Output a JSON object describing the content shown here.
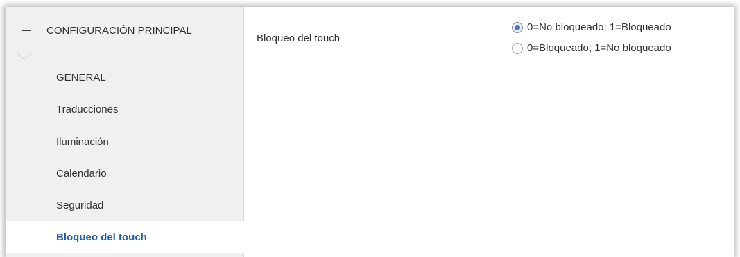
{
  "sidebar": {
    "section_title": "CONFIGURACIÓN PRINCIPAL",
    "items": [
      {
        "label": "GENERAL"
      },
      {
        "label": "Traducciones"
      },
      {
        "label": "Iluminación"
      },
      {
        "label": "Calendario"
      },
      {
        "label": "Seguridad"
      },
      {
        "label": "Bloqueo del touch",
        "active": true
      }
    ]
  },
  "main": {
    "parameter": {
      "label": "Bloqueo del touch",
      "options": [
        {
          "label": "0=No bloqueado; 1=Bloqueado",
          "selected": true
        },
        {
          "label": "0=Bloqueado; 1=No bloqueado",
          "selected": false
        }
      ]
    }
  },
  "colors": {
    "active_item": "#1f5fa8",
    "sidebar_bg": "#f0f0f0",
    "radio_dot": "#4a78b8"
  }
}
